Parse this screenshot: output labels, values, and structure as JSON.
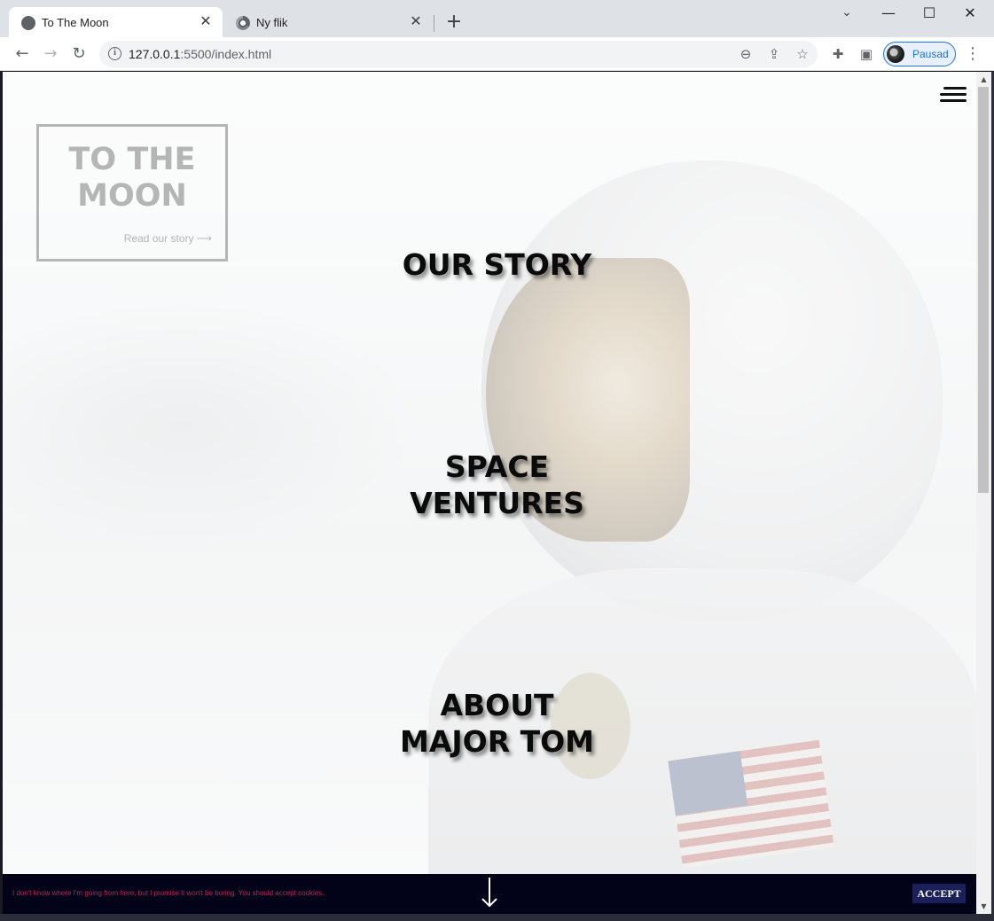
{
  "browser": {
    "tabs": [
      {
        "title": "To The Moon",
        "active": true
      },
      {
        "title": "Ny flik",
        "active": false
      }
    ],
    "close_glyph": "✕",
    "new_tab_glyph": "+",
    "url_host": "127.0.0.1",
    "url_path": ":5500/index.html",
    "profile_name": "Pausad",
    "window_controls": {
      "minimize": "—",
      "maximize": "☐",
      "close": "✕"
    }
  },
  "page": {
    "logo": {
      "title": "TO THE MOON",
      "link": "Read our story ⟶"
    },
    "menu": [
      {
        "label": "OUR STORY"
      },
      {
        "label": "SPACE\nVENTURES"
      },
      {
        "label": "ABOUT\nMAJOR TOM"
      }
    ],
    "cookie": {
      "message": "I don't know where I'm going from here, but I promise it won't be boring. You should accept cookies.",
      "accept_label": "ACCEPT"
    }
  },
  "colors": {
    "cookie_bg": "#020318",
    "cookie_text": "#c0255c",
    "accept_bg": "#1b1f5a",
    "logo": "#b5b5b5"
  },
  "icons": {
    "back": "back-arrow-icon",
    "forward": "forward-arrow-icon",
    "reload": "reload-icon",
    "zoom": "zoom-out-icon",
    "share": "share-icon",
    "bookmark": "star-icon",
    "extensions": "puzzle-icon",
    "sidepanel": "side-panel-icon",
    "menu": "hamburger-icon",
    "scroll_down": "down-arrow-icon"
  }
}
